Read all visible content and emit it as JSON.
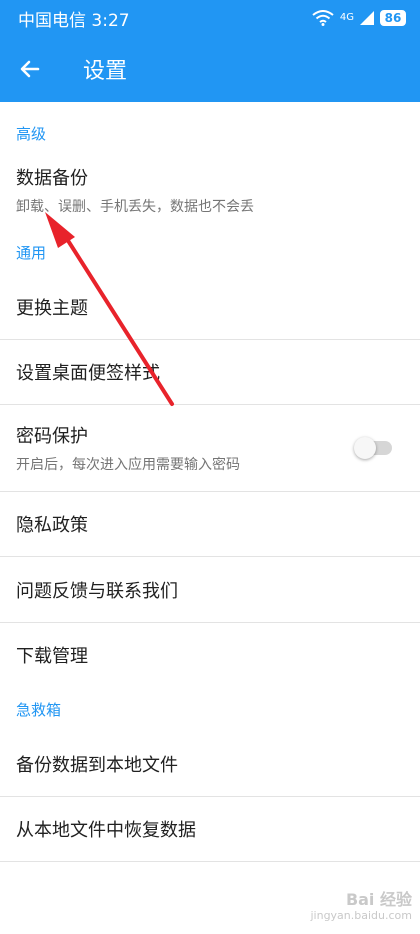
{
  "status_bar": {
    "carrier_time": "中国电信 3:27",
    "network": "4G",
    "battery": "86"
  },
  "app_bar": {
    "title": "设置"
  },
  "sections": {
    "advanced": {
      "header": "高级",
      "backup": {
        "title": "数据备份",
        "subtitle": "卸载、误删、手机丢失，数据也不会丢"
      }
    },
    "general": {
      "header": "通用",
      "theme": {
        "title": "更换主题"
      },
      "note_style": {
        "title": "设置桌面便签样式"
      },
      "password": {
        "title": "密码保护",
        "subtitle": "开启后，每次进入应用需要输入密码",
        "enabled": false
      },
      "privacy": {
        "title": "隐私政策"
      },
      "feedback": {
        "title": "问题反馈与联系我们"
      },
      "downloads": {
        "title": "下载管理"
      }
    },
    "emergency": {
      "header": "急救箱",
      "export": {
        "title": "备份数据到本地文件"
      },
      "restore": {
        "title": "从本地文件中恢复数据"
      }
    }
  },
  "watermark": {
    "text": "Bai 经验",
    "url": "jingyan.baidu.com"
  },
  "colors": {
    "accent": "#2196f3",
    "arrow": "#e8232b"
  }
}
